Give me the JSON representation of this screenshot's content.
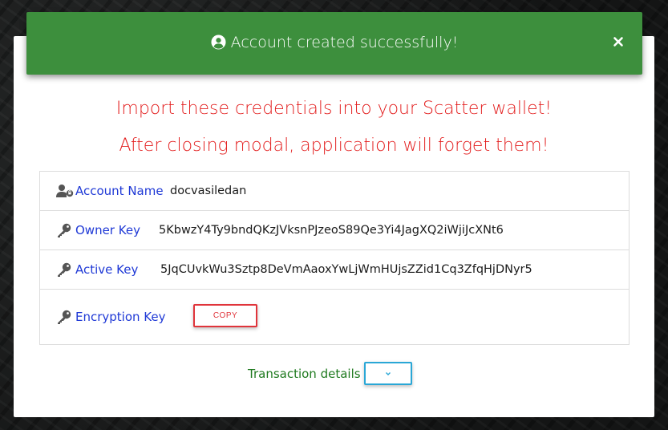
{
  "toast": {
    "icon": "user-circle-icon",
    "message": "Account created successfully!",
    "close_icon": "close-icon",
    "color": "#3d8f3d"
  },
  "modal": {
    "warning_line_1": "Import these credentials into your Scatter wallet!",
    "warning_line_2": "After closing modal, application will forget them!",
    "warning_color": "#e31e1e",
    "credentials": {
      "account": {
        "icon": "user-lock-icon",
        "label": "Account Name",
        "value": "docvasiledan"
      },
      "owner": {
        "icon": "key-icon",
        "label": "Owner Key",
        "value": "5KbwzY4Ty9bndQKzJVksnPJzeoS89Qe3Yi4JagXQ2iWjiJcXNt6"
      },
      "active": {
        "icon": "key-icon",
        "label": "Active Key",
        "value": "5JqCUvkWu3Sztp8DeVmAaoxYwLjWmHUjsZZid1Cq3ZfqHjDNyr5"
      },
      "encryption": {
        "icon": "key-icon",
        "label": "Encryption Key",
        "copy_label": "COPY"
      }
    },
    "transaction": {
      "label": "Transaction details",
      "toggle_icon": "chevron-down-icon"
    }
  }
}
